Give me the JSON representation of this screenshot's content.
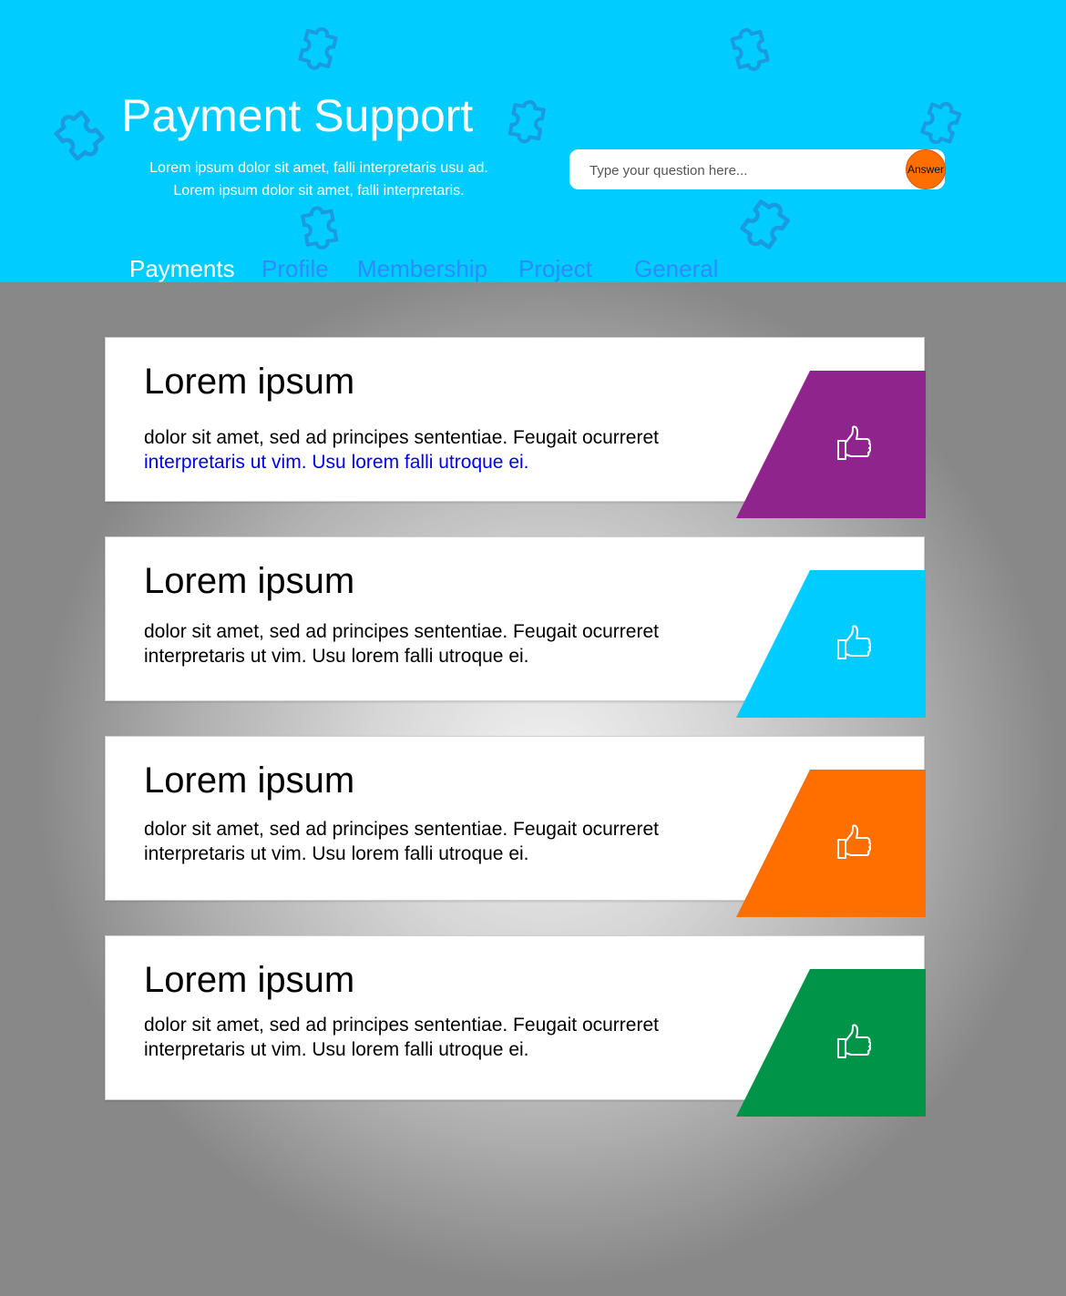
{
  "header": {
    "title": "Payment Support",
    "subtitle_line1": "Lorem ipsum dolor sit amet, falli interpretaris usu ad.",
    "subtitle_line2": "Lorem ipsum dolor sit amet, falli interpretaris.",
    "background_color": "#00ccff"
  },
  "search": {
    "placeholder": "Type your question here...",
    "value": "",
    "button_label": "Answer",
    "button_color": "#ff6f00"
  },
  "tabs": [
    {
      "label": "Payments",
      "active": true
    },
    {
      "label": "Profile",
      "active": false
    },
    {
      "label": "Membership",
      "active": false
    },
    {
      "label": "Project",
      "active": false
    },
    {
      "label": "General",
      "active": false
    }
  ],
  "cards": [
    {
      "title": "Lorem ipsum",
      "body_line1": "dolor sit amet, sed ad principes sententiae. Feugait ocurreret",
      "body_line2": "interpretaris ut vim. Usu lorem falli utroque ei.",
      "body_line2_highlighted": true,
      "accent_color": "#8e248c",
      "icon": "thumbs-up-icon"
    },
    {
      "title": "Lorem ipsum",
      "body_line1": "dolor sit amet, sed ad principes sententiae. Feugait ocurreret",
      "body_line2": "interpretaris ut vim. Usu lorem falli utroque ei.",
      "body_line2_highlighted": false,
      "accent_color": "#00ccff",
      "icon": "thumbs-up-icon"
    },
    {
      "title": "Lorem ipsum",
      "body_line1": "dolor sit amet, sed ad principes sententiae. Feugait ocurreret",
      "body_line2": "interpretaris ut vim. Usu lorem falli utroque ei.",
      "body_line2_highlighted": false,
      "accent_color": "#ff6f00",
      "icon": "thumbs-up-icon"
    },
    {
      "title": "Lorem ipsum",
      "body_line1": "dolor sit amet, sed ad principes sententiae. Feugait ocurreret",
      "body_line2": "interpretaris ut vim. Usu lorem falli utroque ei.",
      "body_line2_highlighted": false,
      "accent_color": "#009448",
      "icon": "thumbs-up-icon"
    }
  ]
}
